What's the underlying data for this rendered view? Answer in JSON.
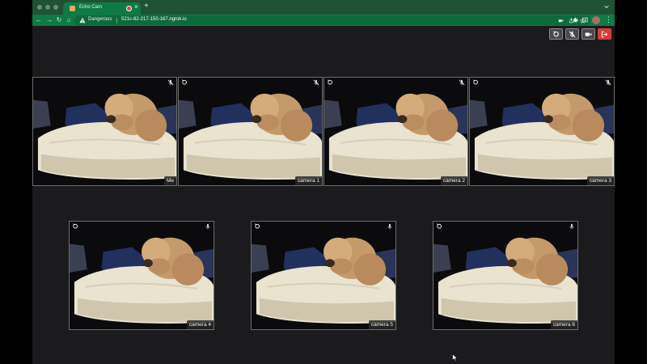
{
  "browser": {
    "tab_title": "Echo Cam",
    "security_label": "Dangerous",
    "url": "521c-82-217-150-167.ngrok.io"
  },
  "controls": {
    "rotate_icon": "rotate-icon",
    "mute_icon": "mic-off-icon",
    "camera_icon": "video-camera-icon",
    "leave_icon": "leave-icon",
    "leave_color": "#d93a3a"
  },
  "tiles": [
    {
      "label": "Me",
      "rotate": false,
      "mic": "mic-off-icon"
    },
    {
      "label": "camera 1",
      "rotate": true,
      "mic": "mic-off-icon"
    },
    {
      "label": "camera 2",
      "rotate": true,
      "mic": "mic-off-icon"
    },
    {
      "label": "camera 3",
      "rotate": true,
      "mic": "mic-off-icon"
    },
    {
      "label": "camera 4",
      "rotate": true,
      "mic": "mic-icon"
    },
    {
      "label": "camera 5",
      "rotate": true,
      "mic": "mic-icon"
    },
    {
      "label": "camera 6",
      "rotate": true,
      "mic": "mic-icon"
    }
  ]
}
